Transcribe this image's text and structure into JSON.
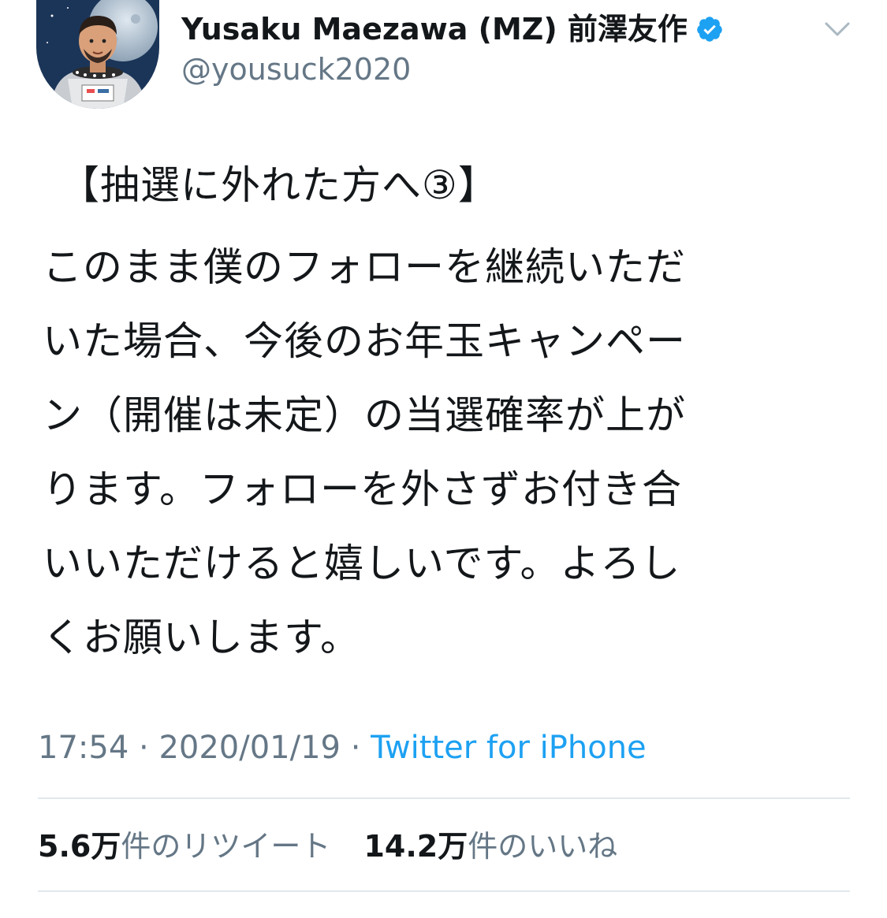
{
  "author": {
    "display_name": "Yusaku Maezawa (MZ) 前澤友作",
    "handle": "@yousuck2020",
    "verified": true
  },
  "tweet": {
    "heading": "【抽選に外れた方へ③】",
    "text": "このまま僕のフォローを継続いただ\nいた場合、今後のお年玉キャンペー\nン（開催は未定）の当選確率が上が\nります。フォローを外さずお付き合\nいいただけると嬉しいです。よろし\nくお願いします。"
  },
  "meta": {
    "time": "17:54",
    "separator": " · ",
    "date": "2020/01/19",
    "source": "Twitter for iPhone"
  },
  "stats": {
    "retweets_count": "5.6万",
    "retweets_label": "件のリツイート",
    "likes_count": "14.2万",
    "likes_label": "件のいいね"
  },
  "icons": {
    "verified": "verified-badge-icon",
    "menu": "chevron-down-icon"
  },
  "colors": {
    "verified": "#1da1f2",
    "link": "#1da1f2",
    "secondary_text": "#657786",
    "primary_text": "#14171a",
    "divider": "#e1e8ed"
  }
}
